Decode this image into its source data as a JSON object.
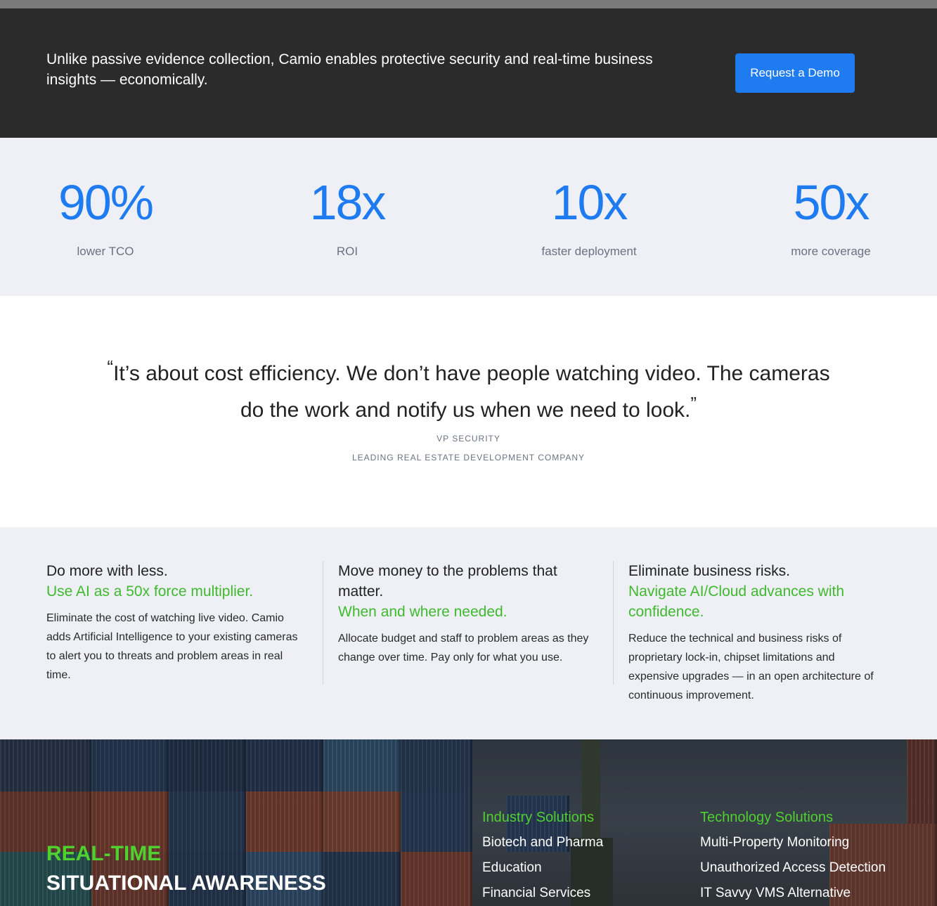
{
  "banner": {
    "text": "Unlike passive evidence collection, Camio enables protective security and real-time business insights — economically.",
    "button_label": "Request a Demo"
  },
  "stats": [
    {
      "value": "90%",
      "label": "lower TCO"
    },
    {
      "value": "18x",
      "label": "ROI"
    },
    {
      "value": "10x",
      "label": "faster deployment"
    },
    {
      "value": "50x",
      "label": "more coverage"
    }
  ],
  "testimonial": {
    "open_mark": "“",
    "close_mark": "”",
    "quote": "It’s about cost efficiency. We don’t have people watching video. The cameras do the work and notify us when we need to look.",
    "role": "VP SECURITY",
    "company": "LEADING REAL ESTATE DEVELOPMENT COMPANY"
  },
  "features": [
    {
      "title": "Do more with less.",
      "subtitle": "Use AI as a 50x force multiplier.",
      "body": "Eliminate the cost of watching live video. Camio adds Artificial Intelligence to your existing cameras to alert you to threats and problem areas in real time."
    },
    {
      "title": "Move money to the problems that matter.",
      "subtitle": "When and where needed.",
      "body": "Allocate budget and staff to problem areas as they change over time. Pay only for what you use."
    },
    {
      "title": "Eliminate business risks.",
      "subtitle": "Navigate AI/Cloud advances with confidence.",
      "body": "Reduce the technical and business risks of proprietary lock-in, chipset limitations and expensive upgrades — in an open architecture of continuous improvement."
    }
  ],
  "hero": {
    "heading_accent": "REAL-TIME",
    "heading_main": "SITUATIONAL AWARENESS",
    "industry": {
      "title": "Industry Solutions",
      "links": [
        "Biotech and Pharma",
        "Education",
        "Financial Services"
      ]
    },
    "technology": {
      "title": "Technology Solutions",
      "links": [
        "Multi-Property Monitoring",
        "Unauthorized Access Detection",
        "IT Savvy VMS Alternative"
      ]
    }
  },
  "colors": {
    "accent_blue": "#1f7bf0",
    "accent_green": "#3fba2e",
    "banner_bg": "#2b2b2b",
    "section_bg": "#eef0f5"
  }
}
